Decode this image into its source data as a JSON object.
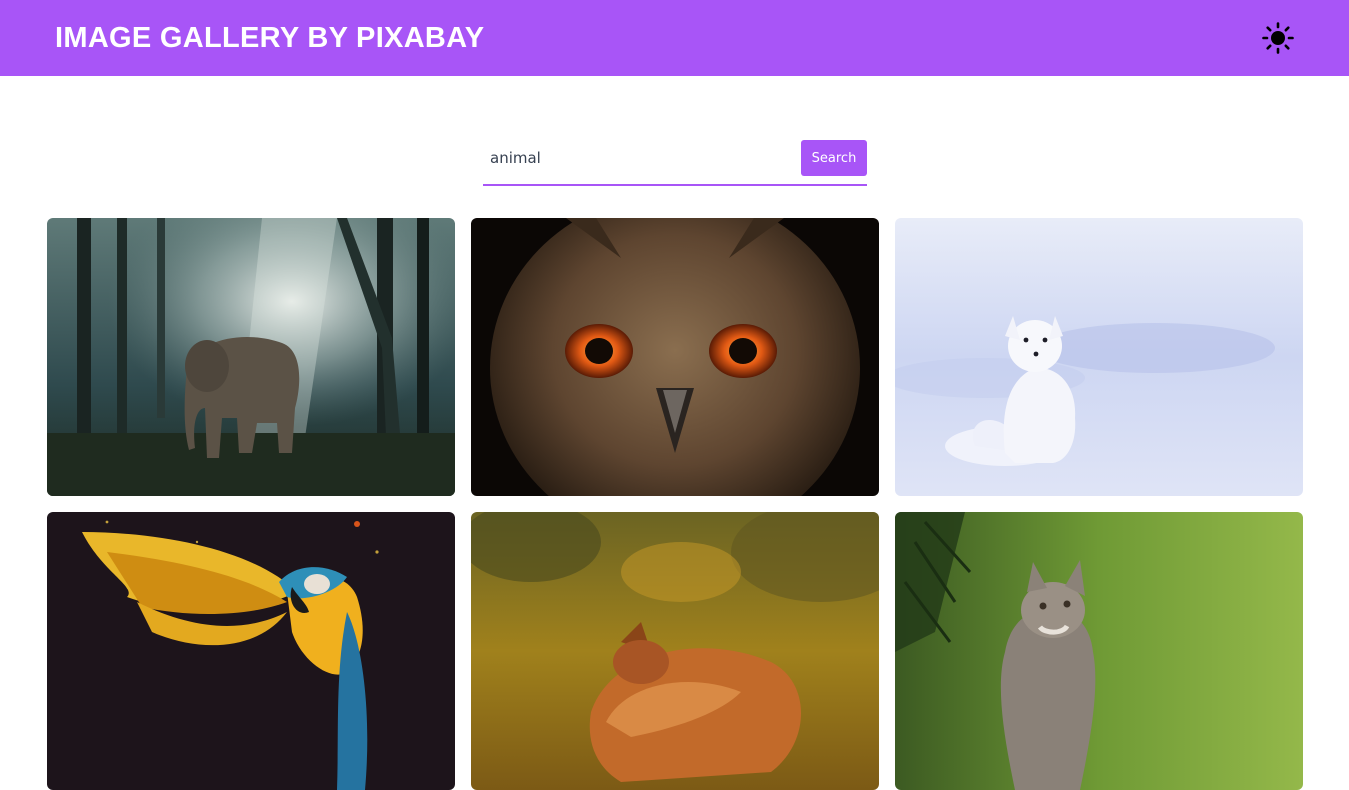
{
  "header": {
    "title": "IMAGE GALLERY BY PIXABAY",
    "theme_icon": "sun-icon"
  },
  "search": {
    "value": "animal",
    "button_label": "Search"
  },
  "gallery": {
    "images": [
      {
        "subject": "elephant-in-forest"
      },
      {
        "subject": "owl-face"
      },
      {
        "subject": "arctic-fox-in-snow"
      },
      {
        "subject": "macaw-parrot"
      },
      {
        "subject": "sleeping-fox"
      },
      {
        "subject": "kitten-in-grass"
      }
    ]
  },
  "colors": {
    "brand": "#a855f7",
    "header_text": "#ffffff"
  }
}
